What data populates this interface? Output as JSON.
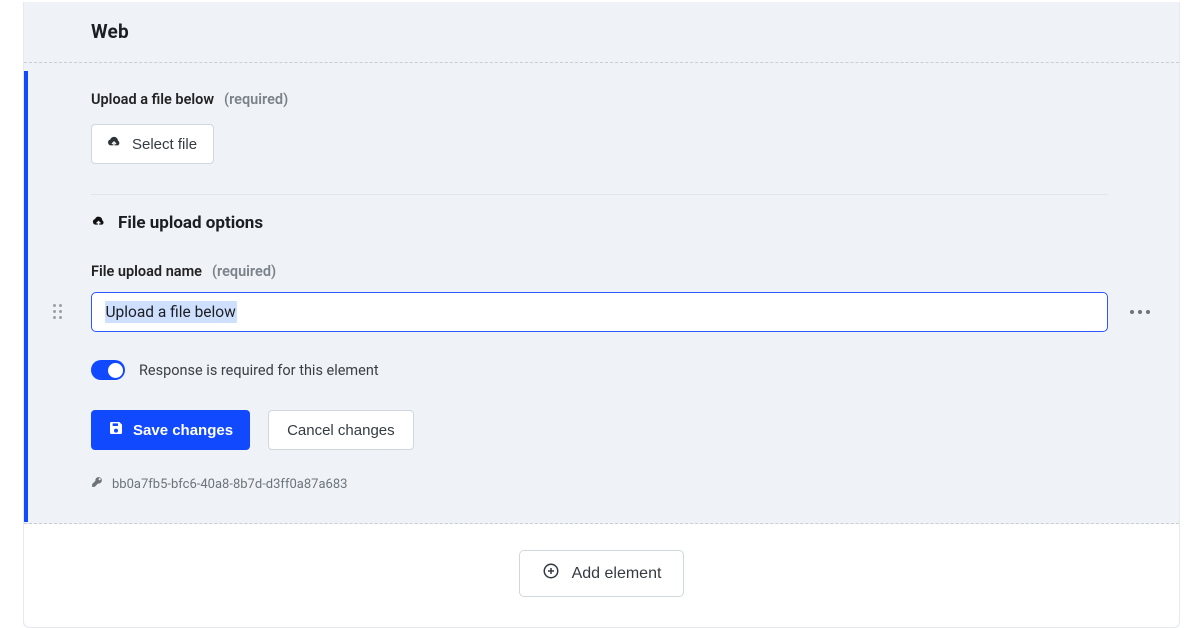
{
  "header": {
    "title": "Web"
  },
  "upload": {
    "label": "Upload a file below",
    "required_text": "(required)",
    "select_label": "Select file"
  },
  "options": {
    "title": "File upload options",
    "name_label": "File upload name",
    "name_required": "(required)",
    "name_value": "Upload a file below",
    "toggle_on": true,
    "toggle_label": "Response is required for this element"
  },
  "actions": {
    "save": "Save changes",
    "cancel": "Cancel changes"
  },
  "key": "bb0a7fb5-bfc6-40a8-8b7d-d3ff0a87a683",
  "footer": {
    "add": "Add element"
  }
}
